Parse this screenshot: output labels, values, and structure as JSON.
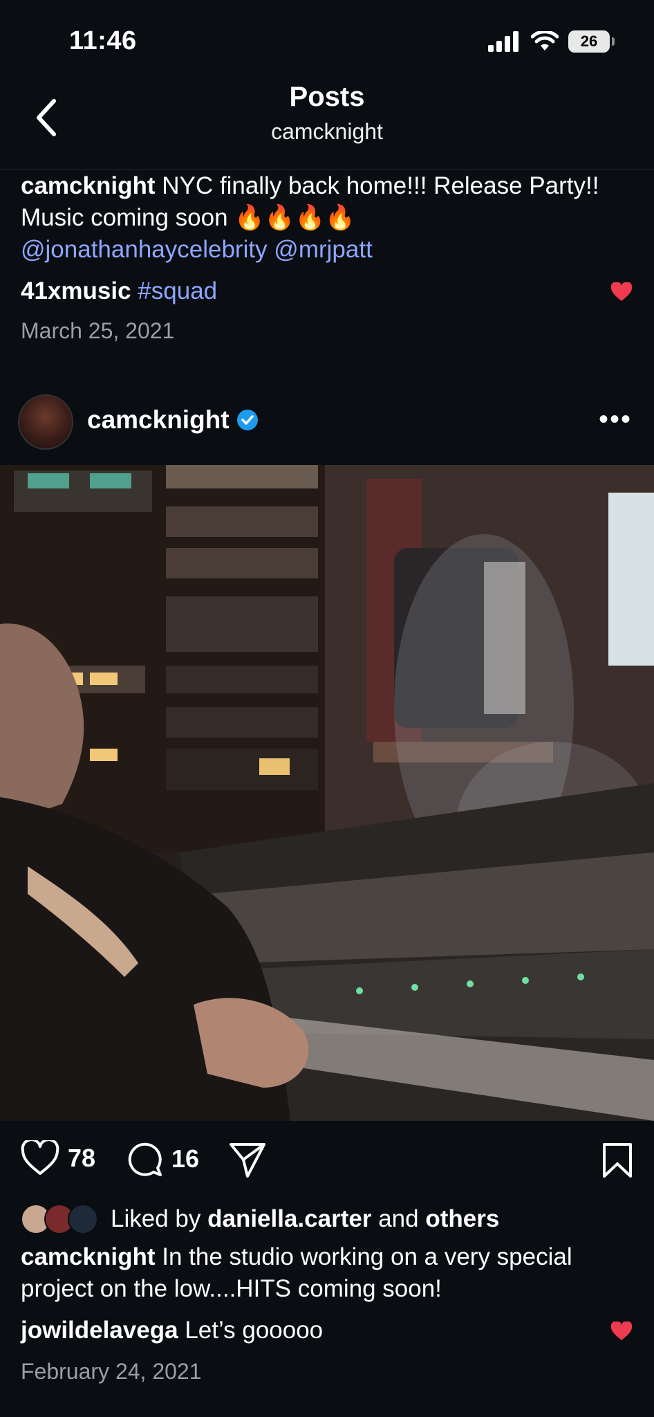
{
  "status": {
    "time": "11:46",
    "battery": "26"
  },
  "header": {
    "title": "Posts",
    "subtitle": "camcknight"
  },
  "post1": {
    "author": "camcknight",
    "text": "NYC finally back home!!! Release Party!! Music coming soon 🔥🔥🔥🔥",
    "mentions": "@jonathanhaycelebrity @mrjpatt",
    "comment_user": "41xmusic",
    "comment_text": "#squad",
    "date": "March 25, 2021"
  },
  "post2": {
    "author": "camcknight",
    "likes": "78",
    "comments": "16",
    "liked_by_prefix": "Liked by",
    "liked_by_user": "daniella.carter",
    "liked_by_and": "and",
    "liked_by_others": "others",
    "caption": "In the studio working on a very special project on the low....HITS coming soon!",
    "comment_user": "jowildelavega",
    "comment_text": "Let’s gooooo",
    "date": "February 24, 2021"
  },
  "colors": {
    "background": "#0a0d12",
    "link": "#8ea7ff",
    "heart": "#ef3b4f",
    "verified": "#1d9bf0"
  },
  "icons": [
    "back-icon",
    "signal-icon",
    "wifi-icon",
    "battery-icon",
    "heart-icon",
    "comment-icon",
    "share-icon",
    "bookmark-icon",
    "verified-icon",
    "more-icon"
  ]
}
